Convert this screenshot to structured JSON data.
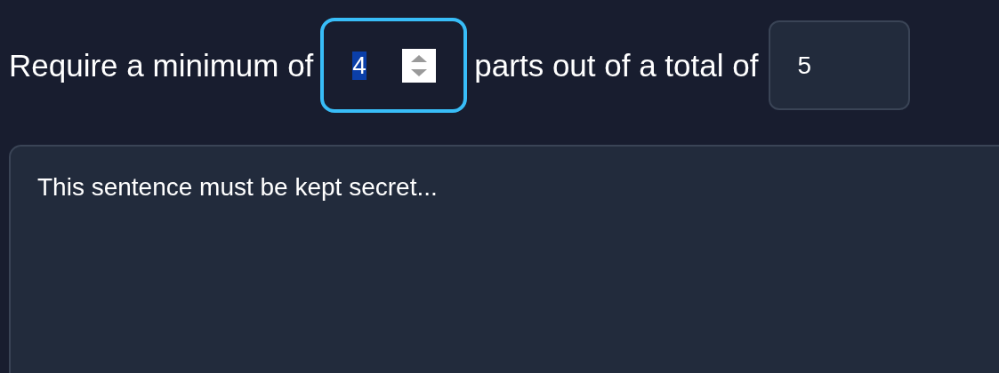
{
  "threshold_row": {
    "label_before": "Require a minimum of",
    "minimum": {
      "value": "4",
      "focused": true,
      "text_selected": true
    },
    "label_middle": "parts out of a total of",
    "total": {
      "value": "5"
    }
  },
  "secret_field": {
    "value": "This sentence must be kept secret..."
  }
}
